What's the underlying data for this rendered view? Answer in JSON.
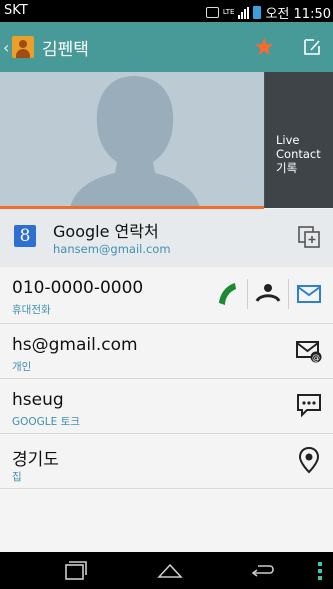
{
  "status_bar": {
    "carrier": "SKT",
    "lte": "LTE",
    "time": "오전 11:50"
  },
  "header": {
    "title": "김펜택",
    "back_icon": "chevron-left-icon",
    "favorite_icon": "star-icon",
    "edit_icon": "edit-icon"
  },
  "photo": {
    "live_panel_label": "Live Contact 기록"
  },
  "account": {
    "title": "Google 연락처",
    "email": "hansem@gmail.com",
    "link_icon": "link-contact-icon"
  },
  "entries": [
    {
      "value": "010-0000-0000",
      "type": "휴대전화"
    },
    {
      "value": "hs@gmail.com",
      "type": "개인"
    },
    {
      "value": "hseug",
      "type": "GOOGLE 토크"
    },
    {
      "value": "경기도",
      "type": "집"
    }
  ],
  "colors": {
    "accent": "#489a99",
    "star": "#ff6a2c",
    "label": "#3f8fb0",
    "call": "#1a8a33",
    "message": "#2f7fd0"
  }
}
